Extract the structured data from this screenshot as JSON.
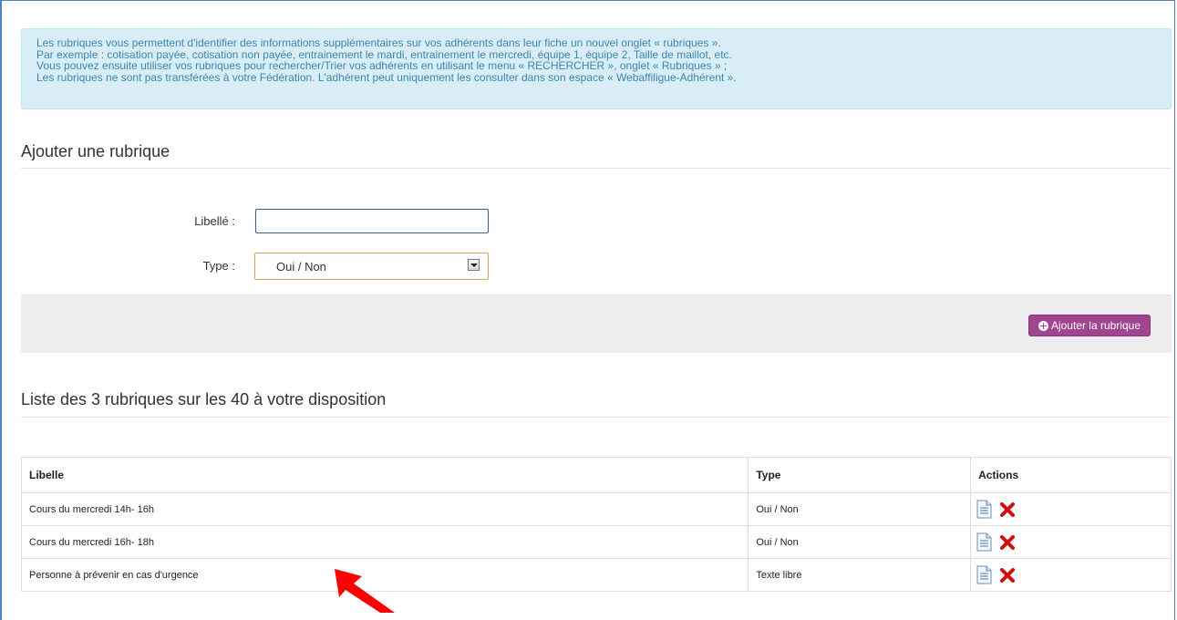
{
  "info": {
    "lines": [
      "Les rubriques vous permettent d'identifier des informations supplémentaires sur vos adhérents dans leur fiche un nouvel onglet « rubriques ».",
      "Par exemple : cotisation payée, cotisation non payée, entrainement le mardi, entrainement le mercredi, équipe 1, équipe 2, Taille de maillot, etc.",
      "Vous pouvez ensuite utiliser vos rubriques pour rechercher/Trier vos adhérents en utilisant le menu « RECHERCHER », onglet « Rubriques » ;",
      "Les rubriques ne sont pas transférées à votre Fédération. L'adhérent peut uniquement les consulter dans son espace « Webaffiligue-Adhérent »."
    ]
  },
  "add_section": {
    "title": "Ajouter une rubrique",
    "libelle_label": "Libellé :",
    "libelle_value": "",
    "type_label": "Type :",
    "type_selected": "Oui / Non",
    "add_button": "Ajouter la rubrique"
  },
  "list_section": {
    "title": "Liste des 3 rubriques sur les 40 à votre disposition",
    "columns": [
      "Libelle",
      "Type",
      "Actions"
    ],
    "rows": [
      {
        "libelle": "Cours du mercredi 14h- 16h",
        "type": "Oui / Non"
      },
      {
        "libelle": "Cours du mercredi 16h- 18h",
        "type": "Oui / Non"
      },
      {
        "libelle": "Personne à prévenir en cas d'urgence",
        "type": "Texte libre"
      }
    ]
  },
  "icons": {
    "edit": "document-icon",
    "delete": "red-x-icon",
    "add": "plus-circle-icon",
    "annotation": "red-arrow-icon"
  },
  "colors": {
    "info_bg": "#d9edf7",
    "info_text": "#3a87ad",
    "button": "#a24591",
    "delete": "#d01010",
    "arrow": "#ff0000"
  }
}
